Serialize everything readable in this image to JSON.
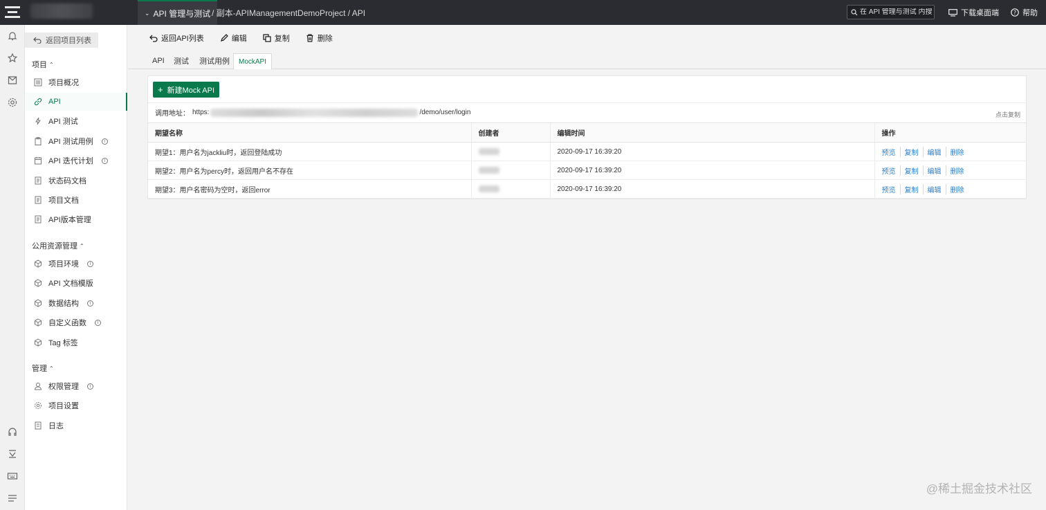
{
  "topbar": {
    "module_label": "API 管理与测试",
    "breadcrumb": "/ 副本-APIManagementDemoProject / API",
    "search_placeholder": "在 API 管理与测试 内搜索",
    "download_label": "下载桌面端",
    "help_label": "帮助"
  },
  "sidebar": {
    "back_label": "返回项目列表",
    "groups": [
      {
        "title": "项目",
        "items": [
          {
            "label": "项目概况",
            "icon": "dashboard-icon"
          },
          {
            "label": "API",
            "icon": "link-icon",
            "active": true
          },
          {
            "label": "API 测试",
            "icon": "bolt-icon"
          },
          {
            "label": "API 测试用例",
            "icon": "clipboard-icon",
            "info": true
          },
          {
            "label": "API 迭代计划",
            "icon": "calendar-icon",
            "info": true
          },
          {
            "label": "状态码文档",
            "icon": "document-icon"
          },
          {
            "label": "项目文档",
            "icon": "document-icon"
          },
          {
            "label": "API版本管理",
            "icon": "document-icon"
          }
        ]
      },
      {
        "title": "公用资源管理",
        "items": [
          {
            "label": "项目环境",
            "icon": "cube-icon",
            "info": true
          },
          {
            "label": "API 文档模版",
            "icon": "cube-icon"
          },
          {
            "label": "数据结构",
            "icon": "cube-icon",
            "info": true
          },
          {
            "label": "自定义函数",
            "icon": "cube-icon",
            "info": true
          },
          {
            "label": "Tag 标签",
            "icon": "cube-icon"
          }
        ]
      },
      {
        "title": "管理",
        "items": [
          {
            "label": "权限管理",
            "icon": "user-icon",
            "info": true
          },
          {
            "label": "项目设置",
            "icon": "gear-icon"
          },
          {
            "label": "日志",
            "icon": "log-icon"
          }
        ]
      }
    ]
  },
  "toolbar": {
    "back_label": "返回API列表",
    "edit_label": "编辑",
    "copy_label": "复制",
    "delete_label": "删除"
  },
  "tabs": [
    "API",
    "测试",
    "测试用例",
    "MockAPI"
  ],
  "active_tab": "MockAPI",
  "mock": {
    "new_button": "新建Mock API",
    "url_label": "调用地址：",
    "url_prefix": "https:",
    "url_suffix": "/demo/user/login",
    "copy_label": "点击复制",
    "columns": [
      "期望名称",
      "创建者",
      "编辑时间",
      "操作"
    ],
    "rows": [
      {
        "name": "期望1：用户名为jackliu时，返回登陆成功",
        "time": "2020-09-17 16:39:20"
      },
      {
        "name": "期望2：用户名为percy时，返回用户名不存在",
        "time": "2020-09-17 16:39:20"
      },
      {
        "name": "期望3：用户名密码为空时，返回error",
        "time": "2020-09-17 16:39:20"
      }
    ],
    "actions": [
      "预览",
      "复制",
      "编辑",
      "删除"
    ]
  },
  "watermark": "@稀土掘金技术社区",
  "colors": {
    "topbar": "#2b2c31",
    "accent": "#0a7a4d",
    "link": "#2a7fc9"
  }
}
